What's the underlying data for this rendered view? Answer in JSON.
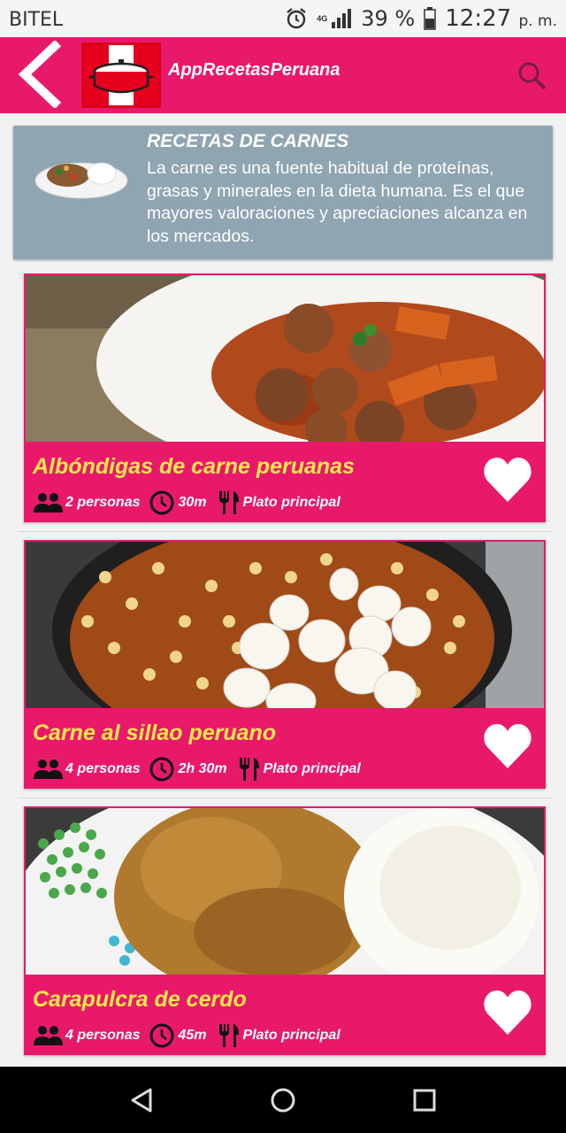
{
  "status_bar": {
    "carrier": "BITEL",
    "network": "4G",
    "battery": "39 %",
    "time": "12:27",
    "ampm": "p. m."
  },
  "app_bar": {
    "title": "AppRecetasPeruana",
    "icons": [
      "back-arrow-icon",
      "app-logo-pot-icon",
      "search-icon"
    ]
  },
  "category": {
    "title": "RECETAS DE CARNES",
    "description": "La carne es una fuente habitual de proteínas, grasas y minerales en la dieta humana. Es el que mayores valoraciones y apreciaciones alcanza en los mercados."
  },
  "recipes": [
    {
      "name": "Albóndigas de carne peruanas",
      "servings": "2 personas",
      "time": "30m",
      "category": "Plato principal"
    },
    {
      "name": "Carne al sillao peruano",
      "servings": "4 personas",
      "time": "2h 30m",
      "category": "Plato principal"
    },
    {
      "name": "Carapulcra de cerdo",
      "servings": "4 personas",
      "time": "45m",
      "category": "Plato principal"
    }
  ],
  "colors": {
    "primary": "#e8196b",
    "recipe_title": "#ffe94a",
    "banner_bg": "#8fa5b1",
    "navbar": "#000000"
  }
}
